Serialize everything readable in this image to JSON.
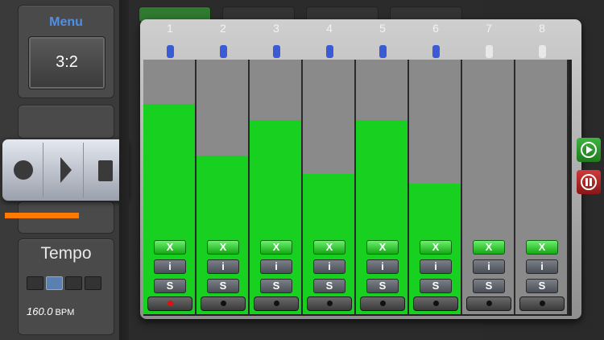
{
  "menu": {
    "title": "Menu",
    "ratio": "3:2"
  },
  "transport": {
    "icons": [
      "record-icon",
      "play-icon",
      "stop-icon"
    ]
  },
  "progress": {
    "fraction": 0.6
  },
  "tempo": {
    "title": "Tempo",
    "bpm_value": "160.0",
    "bpm_unit": "BPM",
    "active_indicator": 1
  },
  "mixer": {
    "channels": [
      {
        "number": "1",
        "level": 0.9,
        "pan_color": "#3b5bd6",
        "mute": "X",
        "info": "i",
        "solo": "S",
        "record_active": true
      },
      {
        "number": "2",
        "level": 0.68,
        "pan_color": "#3b5bd6",
        "mute": "X",
        "info": "i",
        "solo": "S",
        "record_active": false
      },
      {
        "number": "3",
        "level": 0.83,
        "pan_color": "#3b5bd6",
        "mute": "X",
        "info": "i",
        "solo": "S",
        "record_active": false
      },
      {
        "number": "4",
        "level": 0.6,
        "pan_color": "#3b5bd6",
        "mute": "X",
        "info": "i",
        "solo": "S",
        "record_active": false
      },
      {
        "number": "5",
        "level": 0.83,
        "pan_color": "#3b5bd6",
        "mute": "X",
        "info": "i",
        "solo": "S",
        "record_active": false
      },
      {
        "number": "6",
        "level": 0.56,
        "pan_color": "#3b5bd6",
        "mute": "X",
        "info": "i",
        "solo": "S",
        "record_active": false
      },
      {
        "number": "7",
        "level": 0.0,
        "pan_color": "#e8e8e8",
        "mute": "X",
        "info": "i",
        "solo": "S",
        "record_active": false
      },
      {
        "number": "8",
        "level": 0.0,
        "pan_color": "#e8e8e8",
        "mute": "X",
        "info": "i",
        "solo": "S",
        "record_active": false
      }
    ]
  },
  "side_controls": {
    "play": "play-circle-icon",
    "pause": "pause-circle-icon"
  },
  "colors": {
    "meter": "#18d020",
    "accent_blue": "#4f8fe6",
    "progress": "#ff7a00",
    "play_button": "#2e9a2e",
    "pause_button": "#b02424"
  }
}
